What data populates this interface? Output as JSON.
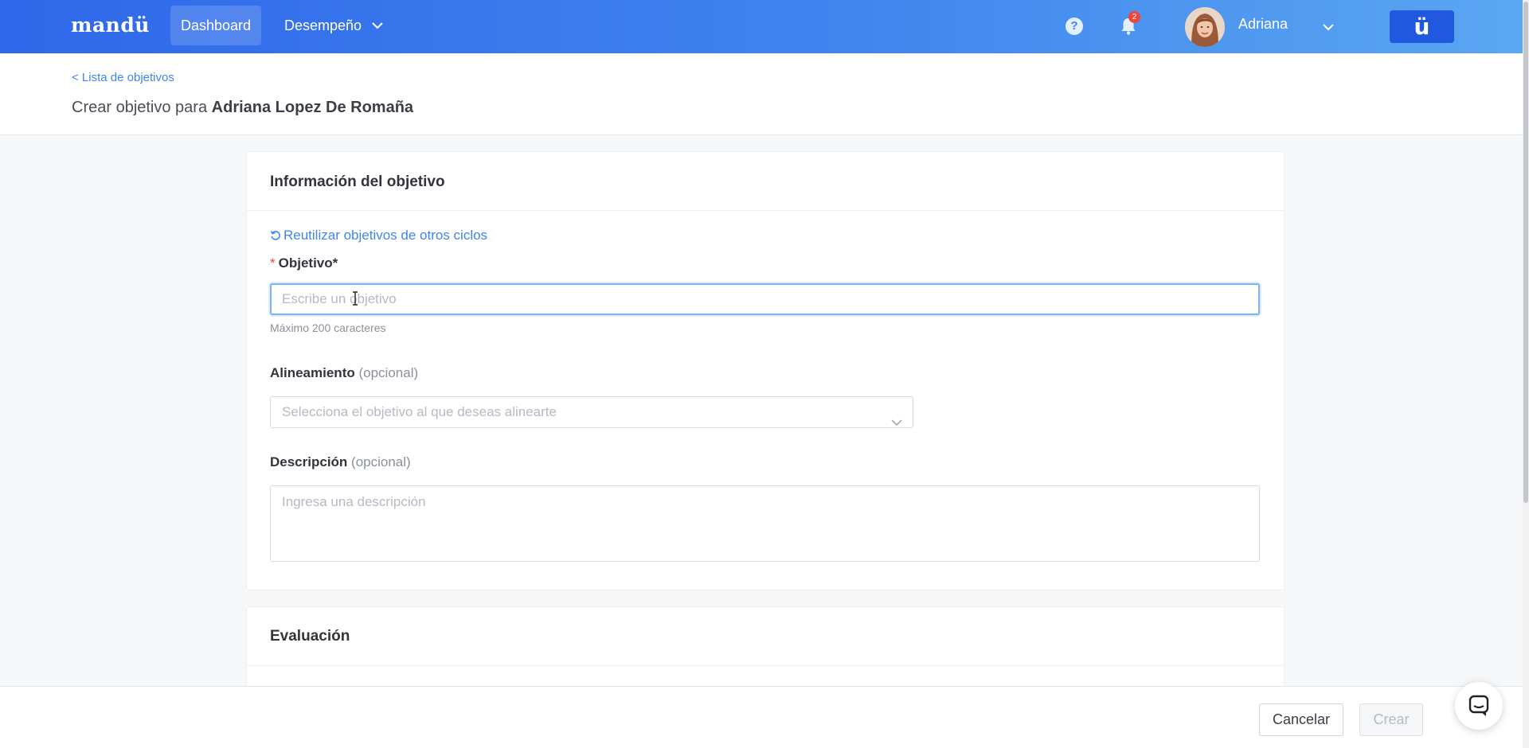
{
  "nav": {
    "logo": "mandü",
    "items": [
      {
        "label": "Dashboard",
        "active": true
      },
      {
        "label": "Desempeño",
        "dropdown": true
      }
    ],
    "help_icon": "question-circle-icon",
    "notifications": {
      "icon": "bell-icon",
      "count": "2"
    },
    "user": {
      "name": "Adriana"
    },
    "brand_button": "ü"
  },
  "header": {
    "breadcrumb": "< Lista de objetivos",
    "title_prefix": "Crear objetivo para",
    "title_name": "Adriana Lopez De Romaña"
  },
  "info_card": {
    "title": "Información del objetivo",
    "reuse_link": "Reutilizar objetivos de otros ciclos",
    "objective": {
      "required_mark": "*",
      "label": "Objetivo*",
      "placeholder": "Escribe un objetivo",
      "value": "",
      "hint": "Máximo 200 caracteres"
    },
    "alignment": {
      "label": "Alineamiento",
      "optional": "(opcional)",
      "placeholder": "Selecciona el objetivo al que deseas alinearte"
    },
    "description": {
      "label": "Descripción",
      "optional": "(opcional)",
      "placeholder": "Ingresa una descripción"
    }
  },
  "eval_card": {
    "title": "Evaluación"
  },
  "footer": {
    "cancel_label": "Cancelar",
    "create_label": "Crear"
  },
  "colors": {
    "accent": "#3f85ee",
    "nav_gradient_start": "#2f67ea",
    "nav_gradient_end": "#5aa7f2",
    "required": "#f0443b"
  }
}
